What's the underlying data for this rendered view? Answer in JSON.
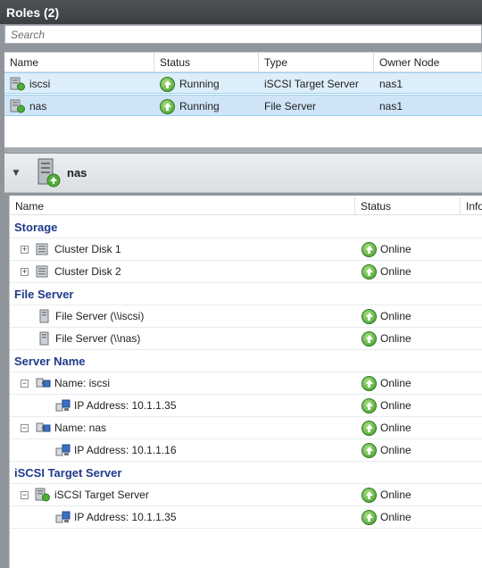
{
  "roles_panel": {
    "title": "Roles (2)",
    "search_placeholder": "Search",
    "columns": [
      "Name",
      "Status",
      "Type",
      "Owner Node"
    ],
    "rows": [
      {
        "name": "iscsi",
        "status": "Running",
        "type": "iSCSI Target Server",
        "owner": "nas1"
      },
      {
        "name": "nas",
        "status": "Running",
        "type": "File Server",
        "owner": "nas1"
      }
    ]
  },
  "detail": {
    "name": "nas",
    "columns": [
      "Name",
      "Status",
      "Info"
    ],
    "groups": {
      "storage": "Storage",
      "file_server": "File Server",
      "server_name": "Server Name",
      "iscsi_target": "iSCSI Target Server"
    },
    "items": {
      "disk1": "Cluster Disk 1",
      "disk2": "Cluster Disk 2",
      "fs_iscsi": "File Server (\\\\iscsi)",
      "fs_nas": "File Server (\\\\nas)",
      "name_iscsi": "Name: iscsi",
      "ip1": "IP Address: 10.1.1.35",
      "name_nas": "Name: nas",
      "ip2": "IP Address: 10.1.1.16",
      "target": "iSCSI Target Server",
      "ip3": "IP Address: 10.1.1.35"
    },
    "status_online": "Online"
  },
  "colors": {
    "header_bg": "#44494e",
    "selection": "#dceefa",
    "group_text": "#1f3a8a",
    "online_green": "#3f9a2c"
  }
}
